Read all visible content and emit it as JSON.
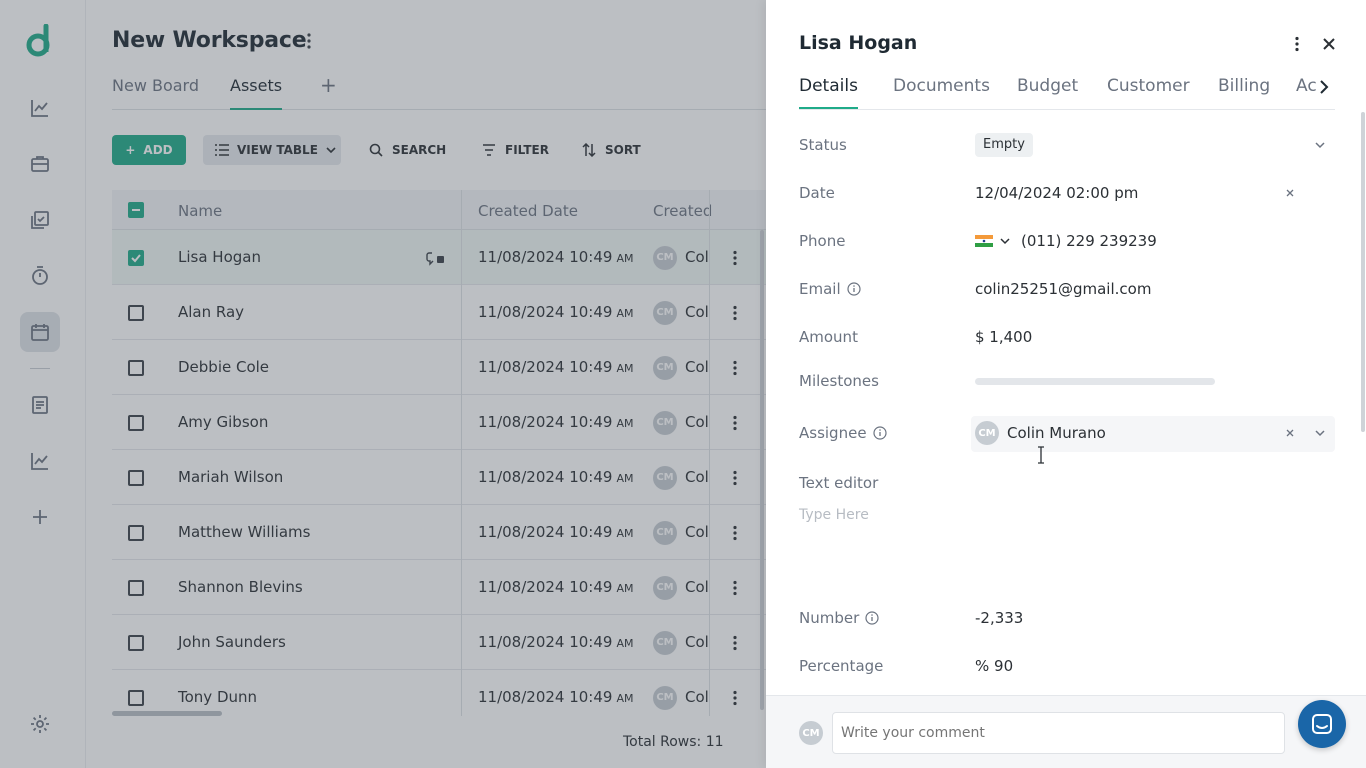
{
  "workspace": {
    "title": "New Workspace",
    "tabs": [
      "New Board",
      "Assets"
    ],
    "active_tab": "Assets"
  },
  "toolbar": {
    "add_label": "ADD",
    "view_label": "VIEW TABLE",
    "search_label": "SEARCH",
    "filter_label": "FILTER",
    "sort_label": "SORT"
  },
  "table": {
    "columns": [
      "Name",
      "Created Date",
      "Created"
    ],
    "rows": [
      {
        "name": "Lisa Hogan",
        "date": "11/08/2024 10:49",
        "ampm": "AM",
        "initials": "CM",
        "creator": "Col",
        "selected": true
      },
      {
        "name": "Alan Ray",
        "date": "11/08/2024 10:49",
        "ampm": "AM",
        "initials": "CM",
        "creator": "Col",
        "selected": false
      },
      {
        "name": "Debbie Cole",
        "date": "11/08/2024 10:49",
        "ampm": "AM",
        "initials": "CM",
        "creator": "Col",
        "selected": false
      },
      {
        "name": "Amy Gibson",
        "date": "11/08/2024 10:49",
        "ampm": "AM",
        "initials": "CM",
        "creator": "Col",
        "selected": false
      },
      {
        "name": "Mariah Wilson",
        "date": "11/08/2024 10:49",
        "ampm": "AM",
        "initials": "CM",
        "creator": "Col",
        "selected": false
      },
      {
        "name": "Matthew Williams",
        "date": "11/08/2024 10:49",
        "ampm": "AM",
        "initials": "CM",
        "creator": "Col",
        "selected": false
      },
      {
        "name": "Shannon Blevins",
        "date": "11/08/2024 10:49",
        "ampm": "AM",
        "initials": "CM",
        "creator": "Col",
        "selected": false
      },
      {
        "name": "John Saunders",
        "date": "11/08/2024 10:49",
        "ampm": "AM",
        "initials": "CM",
        "creator": "Col",
        "selected": false
      },
      {
        "name": "Tony Dunn",
        "date": "11/08/2024 10:49",
        "ampm": "AM",
        "initials": "CM",
        "creator": "Col",
        "selected": false
      }
    ],
    "total": "Total Rows: 11"
  },
  "panel": {
    "title": "Lisa Hogan",
    "tabs": [
      "Details",
      "Documents",
      "Budget",
      "Customer",
      "Billing",
      "Ac"
    ],
    "active_tab": "Details",
    "fields": {
      "status": {
        "label": "Status",
        "value": "Empty"
      },
      "date": {
        "label": "Date",
        "value": "12/04/2024 02:00 pm"
      },
      "phone": {
        "label": "Phone",
        "value": "(011) 229 239239"
      },
      "email": {
        "label": "Email",
        "value": "colin25251@gmail.com"
      },
      "amount": {
        "label": "Amount",
        "value": "$ 1,400"
      },
      "milestones": {
        "label": "Milestones"
      },
      "assignee": {
        "label": "Assignee",
        "initials": "CM",
        "value": "Colin Murano"
      },
      "text_editor": {
        "label": "Text editor",
        "placeholder": "Type Here"
      },
      "number": {
        "label": "Number",
        "value": "-2,333"
      },
      "percentage": {
        "label": "Percentage",
        "value": "% 90"
      }
    },
    "comment": {
      "initials": "CM",
      "placeholder": "Write your comment"
    }
  },
  "colors": {
    "accent": "#1fab89",
    "chat": "#1a66a8",
    "overlay": "rgba(70,78,88,0.36)"
  },
  "icons": {
    "rail": [
      "logo-icon",
      "analytics-icon",
      "briefcase-icon",
      "tasks-icon",
      "timer-icon",
      "calendar-icon",
      "document-icon",
      "trend-icon",
      "plus-icon",
      "settings-icon"
    ]
  }
}
